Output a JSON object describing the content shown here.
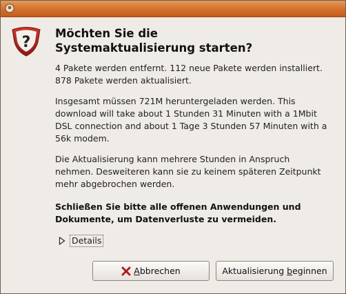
{
  "window": {
    "title": ""
  },
  "dialog": {
    "icon": "question-icon",
    "heading_lines": [
      "Möchten Sie die",
      "Systemaktualisierung starten?"
    ],
    "para1_lines": [
      "4 Pakete werden entfernt. 112 neue Pakete werden installiert.",
      "878 Pakete werden aktualisiert."
    ],
    "para2_lines": [
      "Insgesamt müssen 721M heruntergeladen werden. This",
      "download will take about 1 Stunden 31 Minuten with a 1Mbit",
      "DSL connection and about 1 Tage 3 Stunden 57 Minuten with a",
      "56k modem."
    ],
    "para3_lines": [
      "Die Aktualisierung kann mehrere Stunden in Anspruch",
      "nehmen. Desweiteren kann sie zu keinem späteren Zeitpunkt",
      "mehr abgebrochen werden."
    ],
    "para4_lines": [
      "Schließen Sie bitte alle offenen Anwendungen und",
      "Dokumente, um Datenverluste zu vermeiden."
    ],
    "details_label": "Details"
  },
  "buttons": {
    "cancel": {
      "mnemonic": "A",
      "rest": "bbrechen",
      "icon": "close-x-icon"
    },
    "start": {
      "before": "Aktualisierung ",
      "mnemonic": "b",
      "after": "eginnen"
    }
  },
  "colors": {
    "titlebar": "#d46f2d",
    "window_bg": "#efebe7",
    "icon_red": "#a6221b"
  }
}
